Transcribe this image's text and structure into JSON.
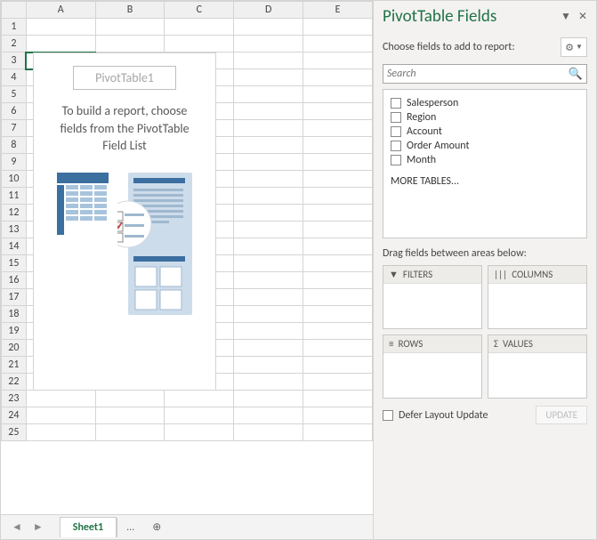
{
  "columns": [
    "A",
    "B",
    "C",
    "D",
    "E"
  ],
  "rows": [
    "1",
    "2",
    "3",
    "4",
    "5",
    "6",
    "7",
    "8",
    "9",
    "10",
    "11",
    "12",
    "13",
    "14",
    "15",
    "16",
    "17",
    "18",
    "19",
    "20",
    "21",
    "22",
    "23",
    "24",
    "25"
  ],
  "selected_cell": "A3",
  "pivot": {
    "title": "PivotTable1",
    "msg_line1": "To build a report, choose",
    "msg_line2": "fields from the PivotTable",
    "msg_line3": "Field List"
  },
  "tabs": {
    "sheet": "Sheet1",
    "dots": "..."
  },
  "pane": {
    "title": "PivotTable Fields",
    "choose": "Choose fields to add to report:",
    "search_placeholder": "Search",
    "fields": [
      "Salesperson",
      "Region",
      "Account",
      "Order Amount",
      "Month"
    ],
    "more": "MORE TABLES...",
    "drag": "Drag fields between areas below:",
    "zones": {
      "filters": "FILTERS",
      "columns": "COLUMNS",
      "rows": "ROWS",
      "values": "VALUES"
    },
    "defer": "Defer Layout Update",
    "update": "UPDATE"
  }
}
